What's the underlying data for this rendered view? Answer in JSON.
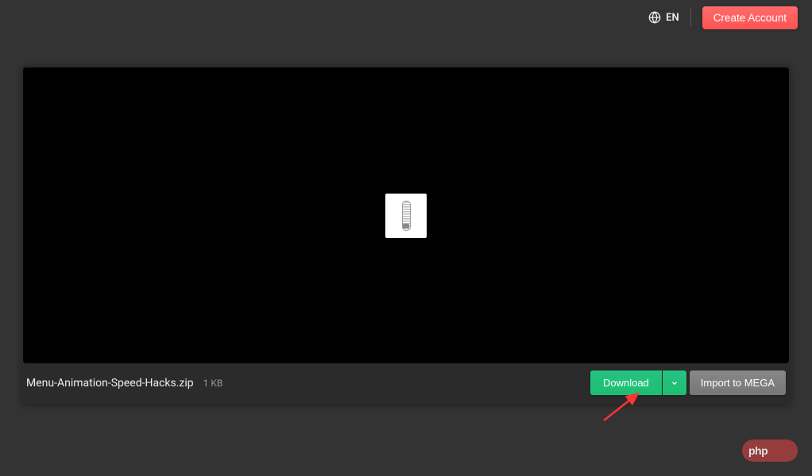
{
  "header": {
    "language_label": "EN",
    "create_account_label": "Create Account"
  },
  "file": {
    "name": "Menu-Animation-Speed-Hacks.zip",
    "size": "1 KB"
  },
  "actions": {
    "download_label": "Download",
    "import_label": "Import to MEGA"
  },
  "watermark": {
    "text_bold": "php",
    "text_light": ""
  }
}
